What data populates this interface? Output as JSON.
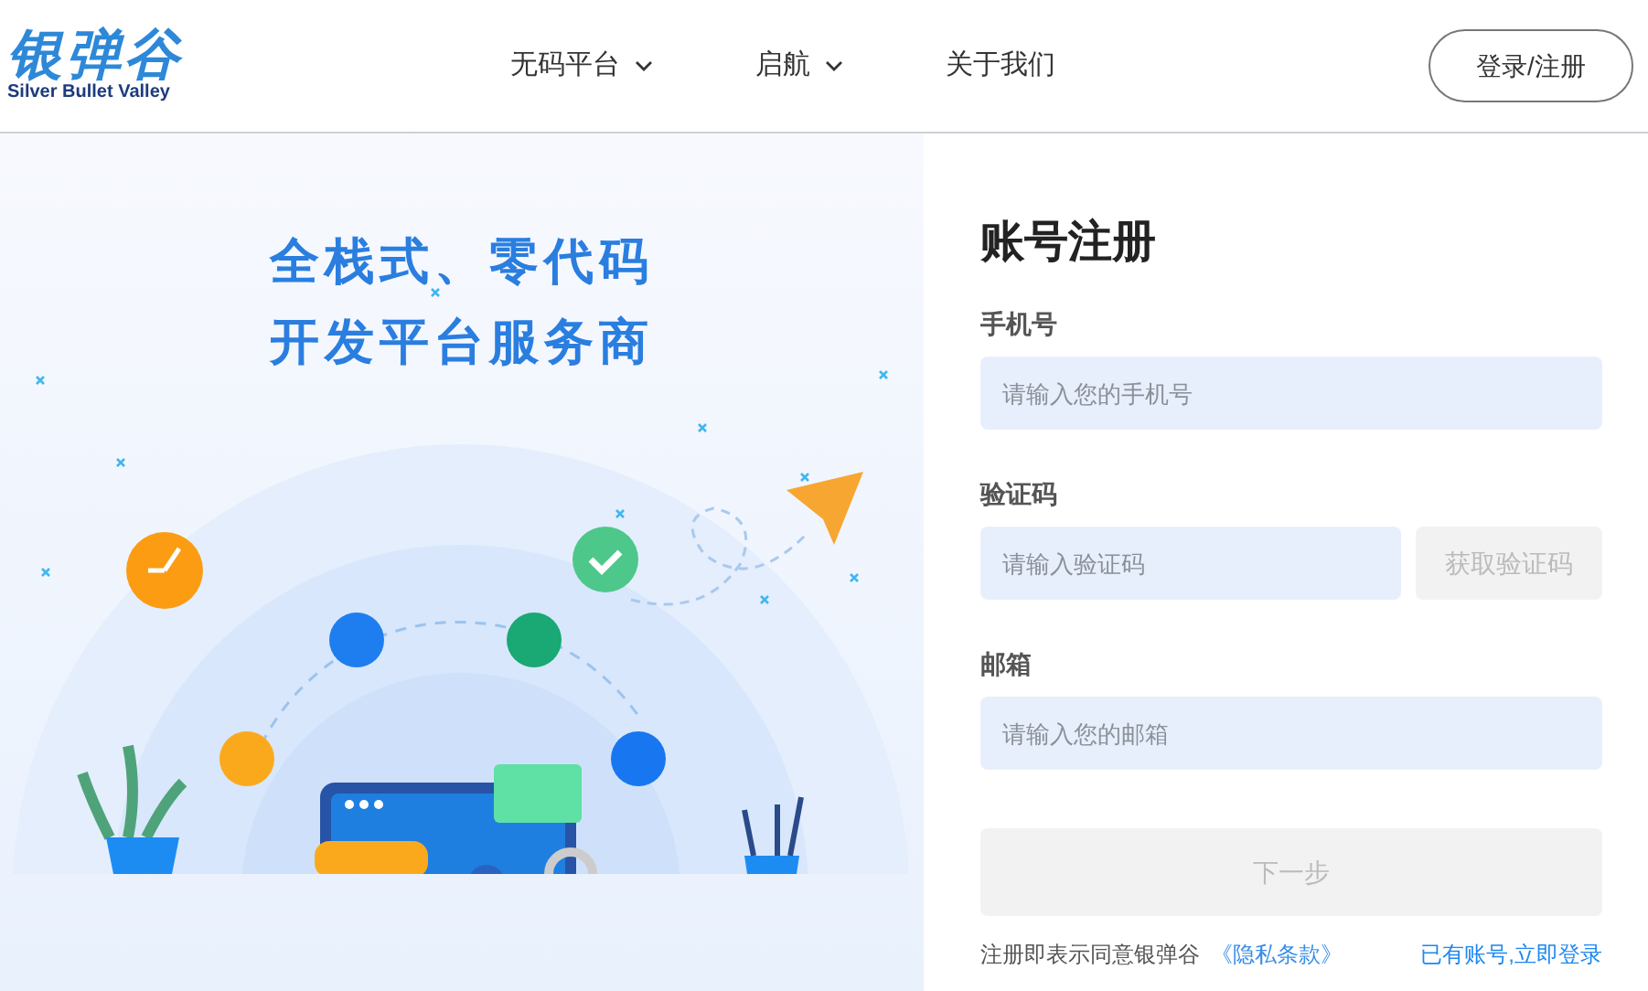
{
  "header": {
    "logo": {
      "mark": "银弹谷",
      "subtitle": "Silver Bullet Valley"
    },
    "nav": [
      {
        "label": "无码平台",
        "has_menu": true
      },
      {
        "label": "启航",
        "has_menu": true
      },
      {
        "label": "关于我们",
        "has_menu": false
      }
    ],
    "login_button": "登录/注册"
  },
  "hero": {
    "headline": [
      "全栈式、零代码",
      "开发平台服务商"
    ]
  },
  "form": {
    "title": "账号注册",
    "fields": [
      {
        "kind": "text",
        "label": "手机号",
        "placeholder": "请输入您的手机号"
      },
      {
        "kind": "code",
        "label": "验证码",
        "placeholder": "请输入验证码",
        "button": "获取验证码"
      },
      {
        "kind": "text",
        "label": "邮箱",
        "placeholder": "请输入您的邮箱"
      }
    ],
    "submit": {
      "label": "下一步",
      "disabled": true
    },
    "agreement": "注册即表示同意银弹谷",
    "privacy_link": "《隐私条款》",
    "login_link": "已有账号,立即登录"
  }
}
